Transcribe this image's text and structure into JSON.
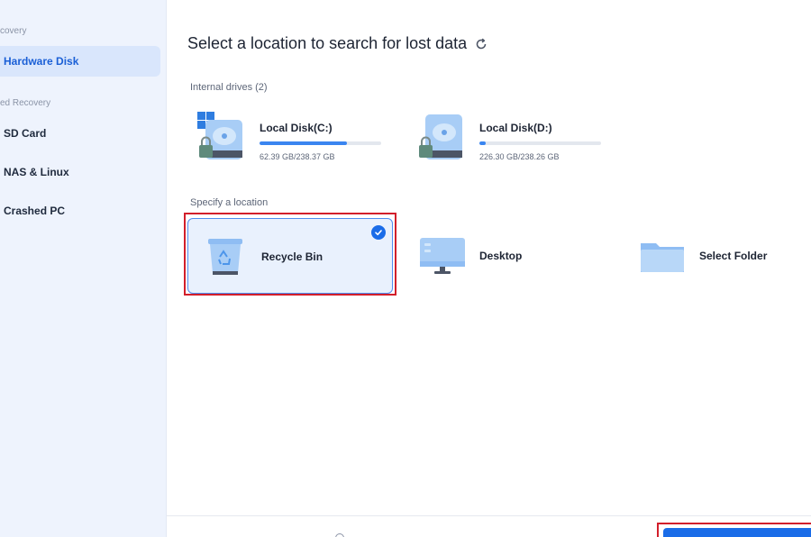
{
  "sidebar": {
    "sections": [
      {
        "label": "covery"
      },
      {
        "label": "ed Recovery"
      }
    ],
    "items": [
      {
        "label": "Hardware Disk",
        "active": true
      },
      {
        "label": "SD Card"
      },
      {
        "label": "NAS & Linux"
      },
      {
        "label": "Crashed PC"
      }
    ]
  },
  "main": {
    "title": "Select a location to search for lost data",
    "internal_label": "Internal drives (2)",
    "drives": [
      {
        "name": "Local Disk(C:)",
        "size": "62.39 GB/238.37 GB",
        "usage_percent": 72
      },
      {
        "name": "Local Disk(D:)",
        "size": "226.30 GB/238.26 GB",
        "usage_percent": 5
      }
    ],
    "specify_label": "Specify a location",
    "locations": [
      {
        "label": "Recycle Bin",
        "selected": true
      },
      {
        "label": "Desktop"
      },
      {
        "label": "Select Folder"
      }
    ]
  },
  "colors": {
    "accent": "#1a6ce8",
    "highlight": "#d21f2b",
    "sidebar_bg": "#eef3fd"
  }
}
